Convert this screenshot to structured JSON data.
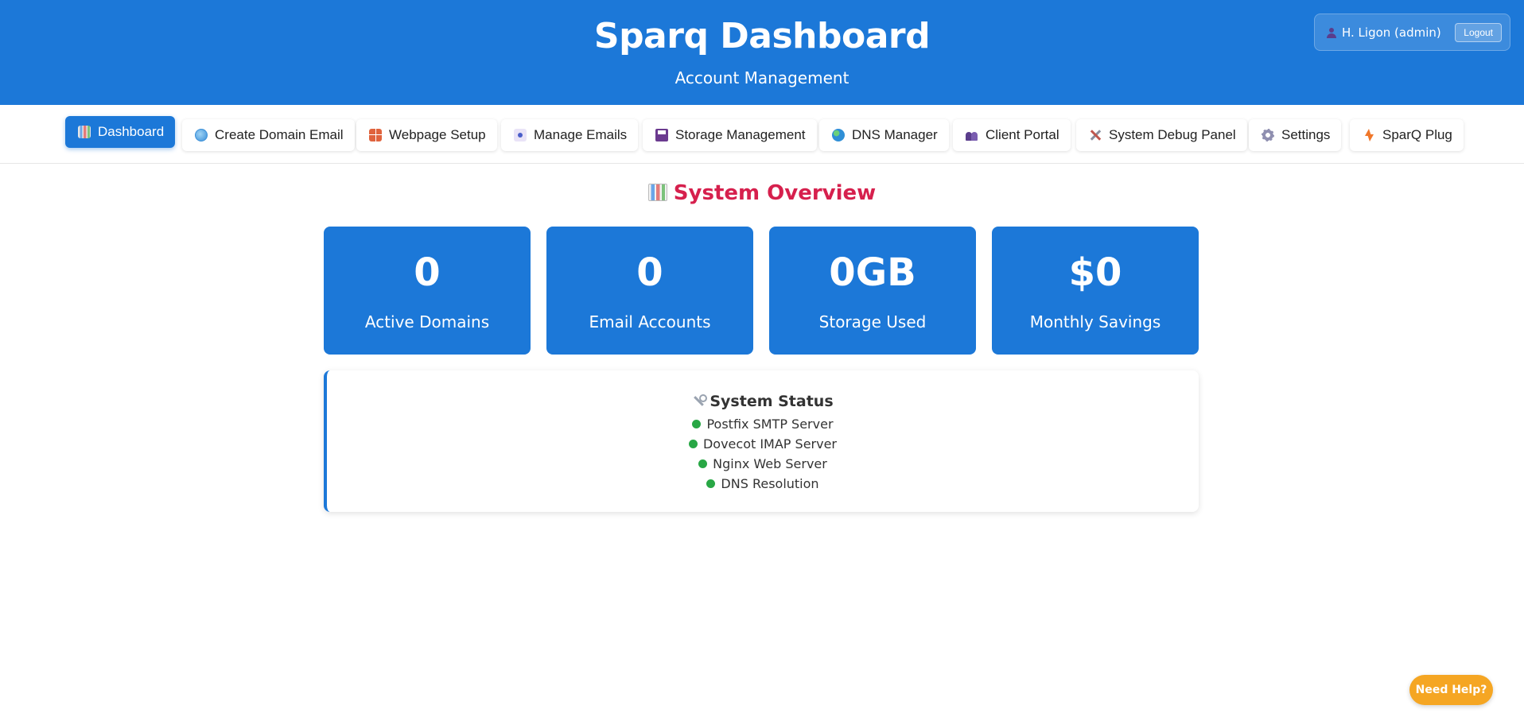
{
  "header": {
    "title": "Sparq Dashboard",
    "subtitle": "Account Management",
    "user_label": "H. Ligon (admin)",
    "user_icon": "user-icon",
    "logout_label": "Logout"
  },
  "nav": {
    "active_index": 0,
    "items": [
      {
        "label": "Dashboard",
        "icon": "bar-chart-icon"
      },
      {
        "label": "Create Domain Email",
        "icon": "globe-icon"
      },
      {
        "label": "Webpage Setup",
        "icon": "brick-icon"
      },
      {
        "label": "Manage Emails",
        "icon": "email-icon"
      },
      {
        "label": "Storage Management",
        "icon": "floppy-disk-icon"
      },
      {
        "label": "DNS Manager",
        "icon": "earth-icon"
      },
      {
        "label": "Client Portal",
        "icon": "people-icon"
      },
      {
        "label": "System Debug Panel",
        "icon": "tools-icon"
      },
      {
        "label": "Settings",
        "icon": "gear-icon"
      },
      {
        "label": "SparQ Plug",
        "icon": "lightning-icon"
      }
    ]
  },
  "overview": {
    "title": "System Overview",
    "title_icon": "bar-chart-icon",
    "stats": [
      {
        "value": "0",
        "label": "Active Domains"
      },
      {
        "value": "0",
        "label": "Email Accounts"
      },
      {
        "value": "0GB",
        "label": "Storage Used"
      },
      {
        "value": "$0",
        "label": "Monthly Savings"
      }
    ]
  },
  "system_status": {
    "title": "System Status",
    "title_icon": "wrench-icon",
    "items": [
      {
        "label": "Postfix SMTP Server",
        "status": "online"
      },
      {
        "label": "Dovecot IMAP Server",
        "status": "online"
      },
      {
        "label": "Nginx Web Server",
        "status": "online"
      },
      {
        "label": "DNS Resolution",
        "status": "online"
      }
    ]
  },
  "help_button": {
    "label": "Need Help?"
  },
  "colors": {
    "primary": "#1c78d8",
    "accent_title": "#d6204d",
    "status_online": "#28a745",
    "help": "#f5a623"
  }
}
